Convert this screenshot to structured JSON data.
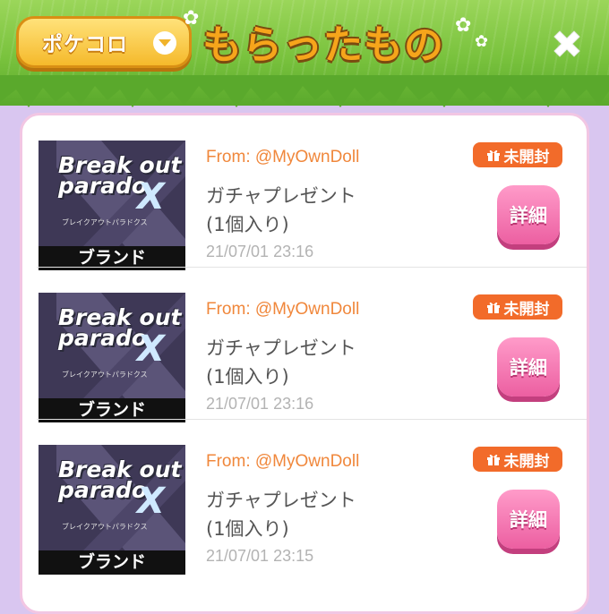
{
  "header": {
    "currency_label": "ポケコロ",
    "title": "もらったもの"
  },
  "items": [
    {
      "thumb_logo": "Break out parado",
      "thumb_logo_x": "X",
      "thumb_sub": "ブレイクアウトパラドクス",
      "thumb_band": "ブランド",
      "from": "From: @MyOwnDoll",
      "title_line1": "ガチャプレゼント",
      "title_line2": "(1個入り)",
      "date": "21/07/01 23:16",
      "badge": "未開封",
      "detail_label": "詳細"
    },
    {
      "thumb_logo": "Break out parado",
      "thumb_logo_x": "X",
      "thumb_sub": "ブレイクアウトパラドクス",
      "thumb_band": "ブランド",
      "from": "From: @MyOwnDoll",
      "title_line1": "ガチャプレゼント",
      "title_line2": "(1個入り)",
      "date": "21/07/01 23:16",
      "badge": "未開封",
      "detail_label": "詳細"
    },
    {
      "thumb_logo": "Break out parado",
      "thumb_logo_x": "X",
      "thumb_sub": "ブレイクアウトパラドクス",
      "thumb_band": "ブランド",
      "from": "From: @MyOwnDoll",
      "title_line1": "ガチャプレゼント",
      "title_line2": "(1個入り)",
      "date": "21/07/01 23:15",
      "badge": "未開封",
      "detail_label": "詳細"
    }
  ],
  "icons": {
    "currency_dropdown": "chevron-down-icon",
    "close": "close-icon",
    "badge": "gift-icon"
  },
  "colors": {
    "accent_orange": "#f26b2a",
    "from_text": "#f0873b",
    "detail_pink": "#ec5fa1",
    "title_gold": "#f6a51b",
    "background_lavender": "#d9c6f0"
  }
}
